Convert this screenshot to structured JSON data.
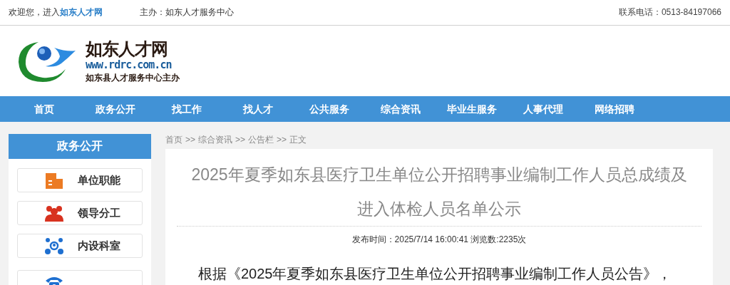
{
  "top_bar": {
    "welcome": "欢迎您，进入",
    "site_link": "如东人才网",
    "host": "主办：如东人才服务中心",
    "phone": "联系电话：0513-84197066"
  },
  "logo": {
    "title": "如东人才网",
    "url": "www.rdrc.com.cn",
    "subtitle": "如东县人才服务中心主办"
  },
  "nav": [
    {
      "label": "首页"
    },
    {
      "label": "政务公开"
    },
    {
      "label": "找工作"
    },
    {
      "label": "找人才"
    },
    {
      "label": "公共服务"
    },
    {
      "label": "综合资讯"
    },
    {
      "label": "毕业生服务"
    },
    {
      "label": "人事代理"
    },
    {
      "label": "网络招聘"
    }
  ],
  "sidebar": {
    "title": "政务公开",
    "items": [
      {
        "label": "单位职能",
        "kind": "building"
      },
      {
        "label": "领导分工",
        "kind": "people"
      },
      {
        "label": "内设科室",
        "kind": "network"
      },
      {
        "kind": "phone"
      }
    ]
  },
  "breadcrumb": [
    {
      "label": "首页"
    },
    {
      "label": "综合资讯"
    },
    {
      "label": "公告栏"
    },
    {
      "label": "正文"
    }
  ],
  "breadcrumb_separator": ">>",
  "article": {
    "title": "2025年夏季如东县医疗卫生单位公开招聘事业编制工作人员总成绩及进入体检人员名单公示",
    "meta": "发布时间：2025/7/14 16:00:41 浏览数:2235次",
    "body": "根据《2025年夏季如东县医疗卫生单位公开招聘事业编制工作人员公告》，"
  }
}
